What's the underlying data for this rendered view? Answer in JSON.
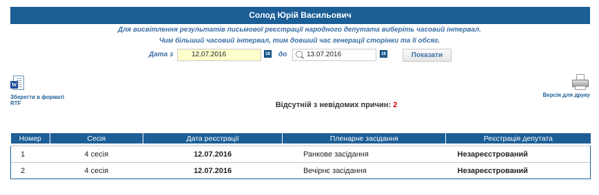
{
  "header": {
    "title": "Солод Юрій Васильович"
  },
  "info": {
    "line1": "Для висвітлення результатів письмової реєстрації народного депутата виберіть часовий інтервал.",
    "line2": "Чим більший часовий інтервал, тим довший час генерації сторінки та її обсяг."
  },
  "filter": {
    "from_label": "Дата з",
    "from_value": "12.07.2016",
    "to_label": "до",
    "to_value": "13.07.2016",
    "calendar_icon_text": "18",
    "show_button": "Показати"
  },
  "export": {
    "rtf_icon_letter": "W",
    "rtf_label_line1": "Зберегти в форматі",
    "rtf_label_line2": "RTF",
    "print_label": "Версія для друку"
  },
  "summary": {
    "absent_label": "Відсутній з невідомих причин:",
    "absent_count": "2"
  },
  "table": {
    "headers": [
      "Номер",
      "Сесія",
      "Дата реєстрації",
      "Пленарне засідання",
      "Реєстрація депутата"
    ],
    "rows": [
      {
        "num": "1",
        "session": "4 сесія",
        "date": "12.07.2016",
        "sitting": "Ранкове засідання",
        "registration": "Незареєстрований"
      },
      {
        "num": "2",
        "session": "4 сесія",
        "date": "12.07.2016",
        "sitting": "Вечірнє засідання",
        "registration": "Незареєстрований"
      }
    ]
  },
  "colors": {
    "header_bg": "#1c5e96",
    "accent_text": "#3a6ea5",
    "alert_red": "#cc0000",
    "date_input_bg": "#ffffcc"
  }
}
